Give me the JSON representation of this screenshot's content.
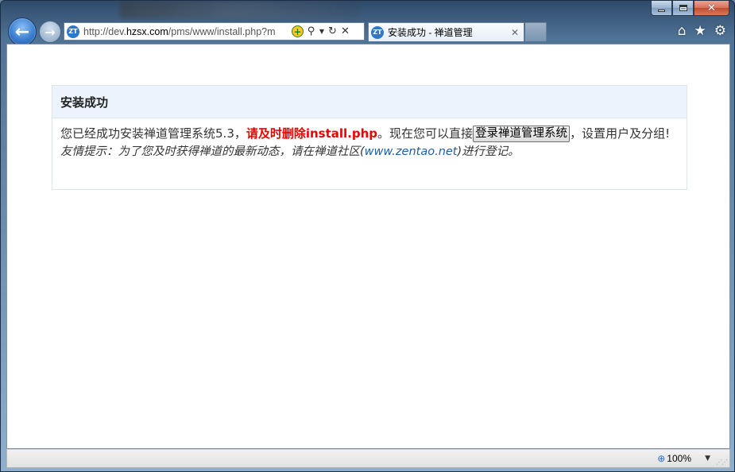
{
  "browser": {
    "url_prefix": "http://dev.",
    "url_host": "hzsx.com",
    "url_rest": "/pms/www/install.php?m",
    "site_icon": "ZT",
    "tab_title": "安装成功 - 禅道管理",
    "zoom": "100%",
    "icons": {
      "back": "back-arrow-icon",
      "forward": "forward-arrow-icon",
      "compat": "compatibility-view-icon",
      "search": "search-icon",
      "refresh": "refresh-icon",
      "stop": "stop-icon",
      "home": "home-icon",
      "favorites": "star-icon",
      "tools": "gear-icon"
    }
  },
  "page": {
    "heading": "安装成功",
    "message_pre": "您已经成功安装禅道管理系统5.3，",
    "message_warning": "请及时删除install.php",
    "message_mid": "。现在您可以直接",
    "login_button": "登录禅道管理系统",
    "message_post": "，设置用户及分组!",
    "tip_pre": "友情提示：为了您及时获得禅道的最新动态，请在禅道社区(",
    "tip_link": "www.zentao.net",
    "tip_post": ")进行登记。"
  },
  "colors": {
    "warning": "#e00000",
    "link": "#1a5fb4",
    "panel_header_bg": "#edf3fd"
  }
}
